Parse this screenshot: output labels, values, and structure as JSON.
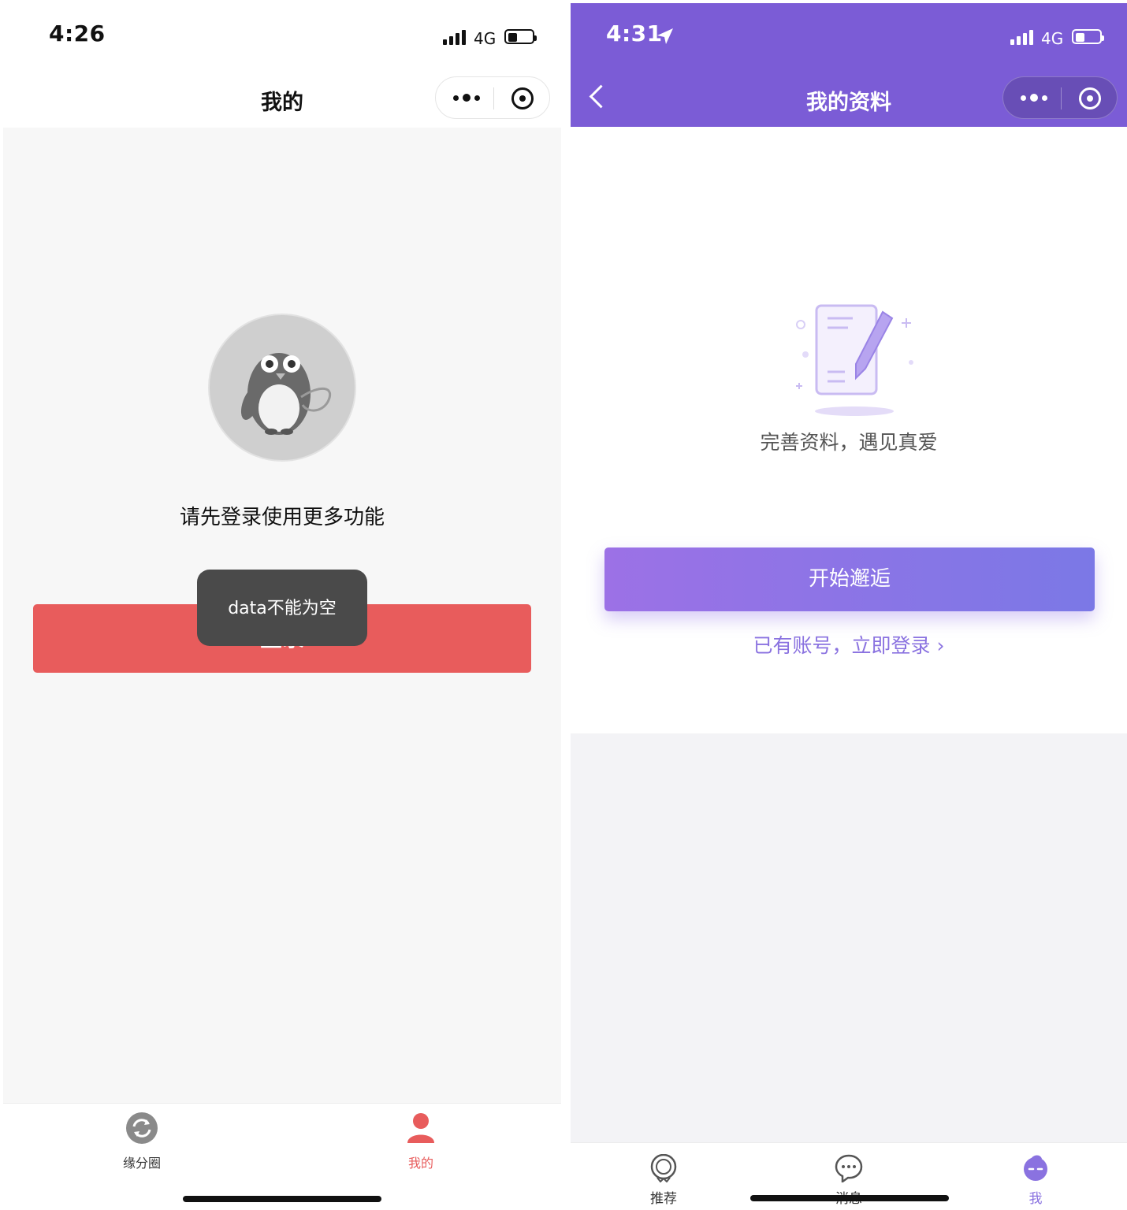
{
  "left": {
    "status": {
      "time": "4:26",
      "network": "4G"
    },
    "nav": {
      "title": "我的"
    },
    "prompt": "请先登录使用更多功能",
    "login_button": "登录",
    "toast": "data不能为空",
    "tabs": [
      {
        "label": "缘分圈",
        "icon": "refresh-circle-icon",
        "active": false
      },
      {
        "label": "我的",
        "icon": "person-icon",
        "active": true
      }
    ],
    "colors": {
      "accent": "#e85c5c",
      "toast_bg": "#4a4a4a"
    }
  },
  "right": {
    "status": {
      "time": "4:31",
      "network": "4G"
    },
    "nav": {
      "title": "我的资料"
    },
    "slogan": "完善资料，遇见真爱",
    "start_button": "开始邂逅",
    "login_link": "已有账号，立即登录 ›",
    "tabs": [
      {
        "label": "推荐",
        "icon": "recommend-icon",
        "active": false
      },
      {
        "label": "消息",
        "icon": "chat-bubble-icon",
        "active": false
      },
      {
        "label": "我",
        "icon": "me-face-icon",
        "active": true
      }
    ],
    "colors": {
      "header": "#7b5cd6",
      "accent": "#8a72e0"
    }
  }
}
